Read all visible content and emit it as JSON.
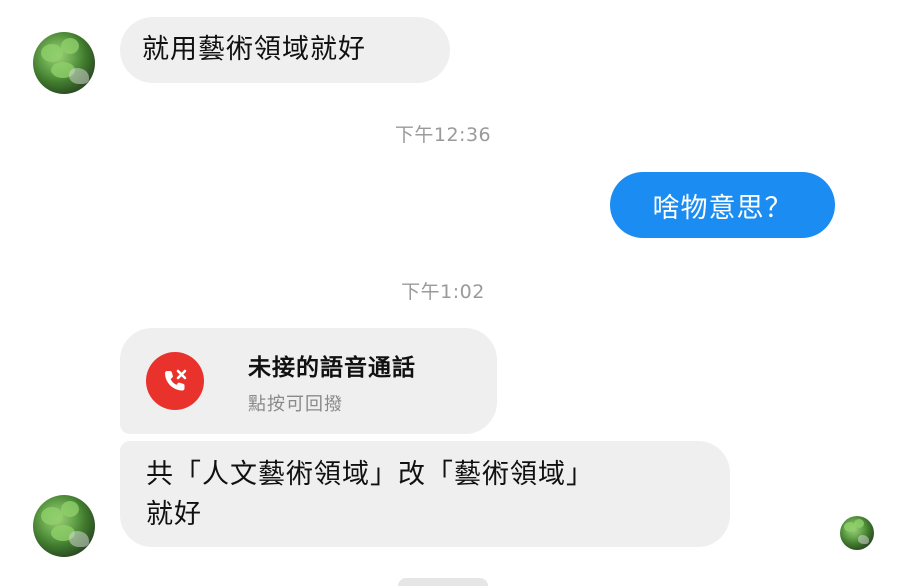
{
  "messages": {
    "first_incoming": "就用藝術領域就好",
    "time_1": "下午12:36",
    "outgoing": "啥物意思？",
    "time_2": "下午1:02",
    "missed_call": {
      "title": "未接的語音通話",
      "subtitle": "點按可回撥"
    },
    "last_incoming_line1": "共「人文藝術領域」改「藝術領域」",
    "last_incoming_line2": "就好"
  },
  "icons": {
    "missed_call": "missed-call-icon",
    "avatar": "contact-avatar",
    "read_receipt": "read-receipt-avatar"
  },
  "colors": {
    "incoming_bubble": "#efefef",
    "outgoing_bubble": "#1b8cf2",
    "missed_call_red": "#e8322b",
    "timestamp_gray": "#9a9a9a"
  }
}
